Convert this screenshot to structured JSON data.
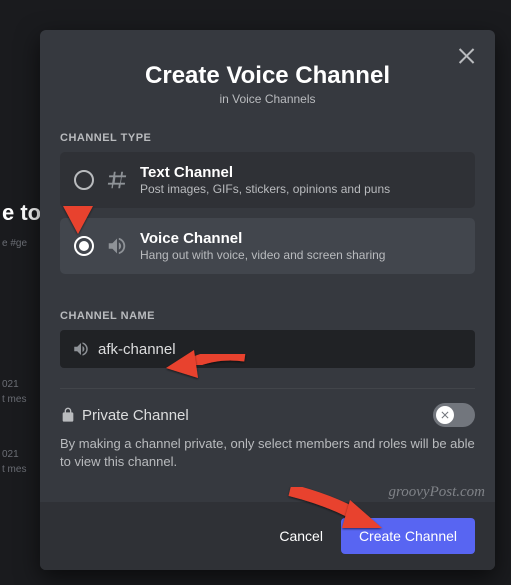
{
  "bg": {
    "fragment1": "e to",
    "fragment2": "e #ge",
    "fragment3": "021",
    "fragment4": "t mes",
    "fragment5": "021",
    "fragment6": "t mes"
  },
  "modal": {
    "title": "Create Voice Channel",
    "subtitle": "in Voice Channels",
    "sections": {
      "channel_type_label": "CHANNEL TYPE",
      "channel_name_label": "CHANNEL NAME"
    },
    "types": {
      "text": {
        "title": "Text Channel",
        "desc": "Post images, GIFs, stickers, opinions and puns",
        "selected": false
      },
      "voice": {
        "title": "Voice Channel",
        "desc": "Hang out with voice, video and screen sharing",
        "selected": true
      }
    },
    "channel_name": "afk-channel",
    "private": {
      "label": "Private Channel",
      "desc": "By making a channel private, only select members and roles will be able to view this channel.",
      "on": false
    },
    "footer": {
      "cancel": "Cancel",
      "create": "Create Channel"
    }
  },
  "watermark": "groovyPost.com"
}
